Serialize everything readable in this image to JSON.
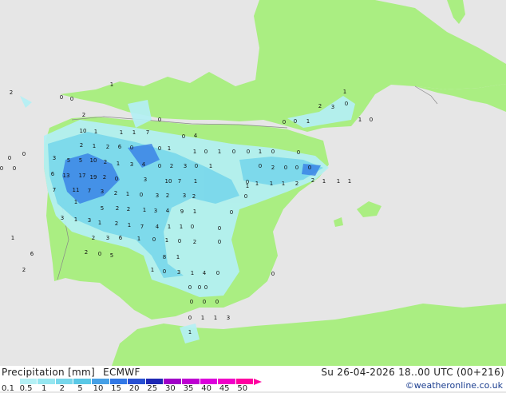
{
  "footer": {
    "product": "Precipitation [mm]",
    "model": "ECMWF",
    "datetime": "Su 26-04-2026 18..00 UTC (00+216)",
    "credit": "©weatheronline.co.uk"
  },
  "legend": {
    "labels": [
      "0.1",
      "0.5",
      "1",
      "2",
      "5",
      "10",
      "15",
      "20",
      "25",
      "30",
      "35",
      "40",
      "45",
      "50"
    ],
    "colors": [
      "#ffffff",
      "#b4f0f5",
      "#96e6f0",
      "#78d7eb",
      "#5ac8e6",
      "#46a0e6",
      "#3278e6",
      "#2850d2",
      "#1e28b4",
      "#a000c8",
      "#be00d2",
      "#dc00dc",
      "#f000c8",
      "#ff00a0"
    ]
  },
  "map": {
    "colors": {
      "sea": "#e6e6e6",
      "land": "#aaee82",
      "border": "#999999",
      "precip_light": "#b4f0f5",
      "precip_mid": "#78d7eb",
      "precip_heavy": "#3278e6"
    },
    "values": [
      {
        "v": "2"
      },
      {
        "v": "0"
      },
      {
        "v": "0"
      },
      {
        "v": "1"
      },
      {
        "v": "1"
      },
      {
        "v": "2"
      },
      {
        "v": "0"
      },
      {
        "v": "0"
      },
      {
        "v": "4"
      },
      {
        "v": "10"
      },
      {
        "v": "1"
      },
      {
        "v": "1"
      },
      {
        "v": "1"
      },
      {
        "v": "7"
      },
      {
        "v": "2"
      },
      {
        "v": "1"
      },
      {
        "v": "2"
      },
      {
        "v": "6"
      },
      {
        "v": "0"
      },
      {
        "v": "0"
      },
      {
        "v": "1"
      },
      {
        "v": "3"
      },
      {
        "v": "5"
      },
      {
        "v": "5"
      },
      {
        "v": "10"
      },
      {
        "v": "2"
      },
      {
        "v": "1"
      },
      {
        "v": "3"
      },
      {
        "v": "4"
      },
      {
        "v": "0"
      },
      {
        "v": "2"
      },
      {
        "v": "3"
      },
      {
        "v": "0"
      },
      {
        "v": "1"
      },
      {
        "v": "6"
      },
      {
        "v": "13"
      },
      {
        "v": "17"
      },
      {
        "v": "19"
      },
      {
        "v": "2"
      },
      {
        "v": "0"
      },
      {
        "v": "3"
      },
      {
        "v": "10"
      },
      {
        "v": "7"
      },
      {
        "v": "1"
      },
      {
        "v": "7"
      },
      {
        "v": "11"
      },
      {
        "v": "7"
      },
      {
        "v": "3"
      },
      {
        "v": "2"
      },
      {
        "v": "1"
      },
      {
        "v": "0"
      },
      {
        "v": "3"
      },
      {
        "v": "2"
      },
      {
        "v": "3"
      },
      {
        "v": "2"
      },
      {
        "v": "1"
      },
      {
        "v": "5"
      },
      {
        "v": "2"
      },
      {
        "v": "2"
      },
      {
        "v": "1"
      },
      {
        "v": "3"
      },
      {
        "v": "4"
      },
      {
        "v": "9"
      },
      {
        "v": "1"
      },
      {
        "v": "3"
      },
      {
        "v": "1"
      },
      {
        "v": "3"
      },
      {
        "v": "1"
      },
      {
        "v": "2"
      },
      {
        "v": "1"
      },
      {
        "v": "7"
      },
      {
        "v": "4"
      },
      {
        "v": "1"
      },
      {
        "v": "1"
      },
      {
        "v": "0"
      },
      {
        "v": "2"
      },
      {
        "v": "3"
      },
      {
        "v": "6"
      },
      {
        "v": "1"
      },
      {
        "v": "0"
      },
      {
        "v": "1"
      },
      {
        "v": "0"
      },
      {
        "v": "2"
      },
      {
        "v": "2"
      },
      {
        "v": "0"
      },
      {
        "v": "5"
      },
      {
        "v": "8"
      },
      {
        "v": "1"
      },
      {
        "v": "1"
      },
      {
        "v": "0"
      },
      {
        "v": "3"
      },
      {
        "v": "1"
      },
      {
        "v": "4"
      },
      {
        "v": "0"
      },
      {
        "v": "0"
      },
      {
        "v": "0"
      },
      {
        "v": "0"
      },
      {
        "v": "0"
      },
      {
        "v": "0"
      },
      {
        "v": "0"
      },
      {
        "v": "0"
      },
      {
        "v": "1"
      },
      {
        "v": "1"
      },
      {
        "v": "3"
      },
      {
        "v": "1"
      },
      {
        "v": "1"
      },
      {
        "v": "6"
      },
      {
        "v": "2"
      },
      {
        "v": "1"
      },
      {
        "v": "1"
      },
      {
        "v": "1"
      },
      {
        "v": "1"
      },
      {
        "v": "2"
      },
      {
        "v": "2"
      },
      {
        "v": "1"
      },
      {
        "v": "1"
      },
      {
        "v": "1"
      },
      {
        "v": "0"
      },
      {
        "v": "0"
      },
      {
        "v": "1"
      },
      {
        "v": "2"
      },
      {
        "v": "3"
      },
      {
        "v": "0"
      },
      {
        "v": "1"
      },
      {
        "v": "0"
      },
      {
        "v": "1"
      },
      {
        "v": "0"
      },
      {
        "v": "1"
      },
      {
        "v": "0"
      },
      {
        "v": "0"
      },
      {
        "v": "1"
      },
      {
        "v": "0"
      },
      {
        "v": "0"
      },
      {
        "v": "0"
      },
      {
        "v": "2"
      },
      {
        "v": "0"
      },
      {
        "v": "0"
      },
      {
        "v": "0"
      },
      {
        "v": "0"
      },
      {
        "v": "0"
      },
      {
        "v": "0"
      },
      {
        "v": "0"
      },
      {
        "v": "0"
      },
      {
        "v": "0"
      },
      {
        "v": "0"
      },
      {
        "v": "0"
      },
      {
        "v": "0"
      },
      {
        "v": "0"
      },
      {
        "v": "0"
      }
    ]
  }
}
